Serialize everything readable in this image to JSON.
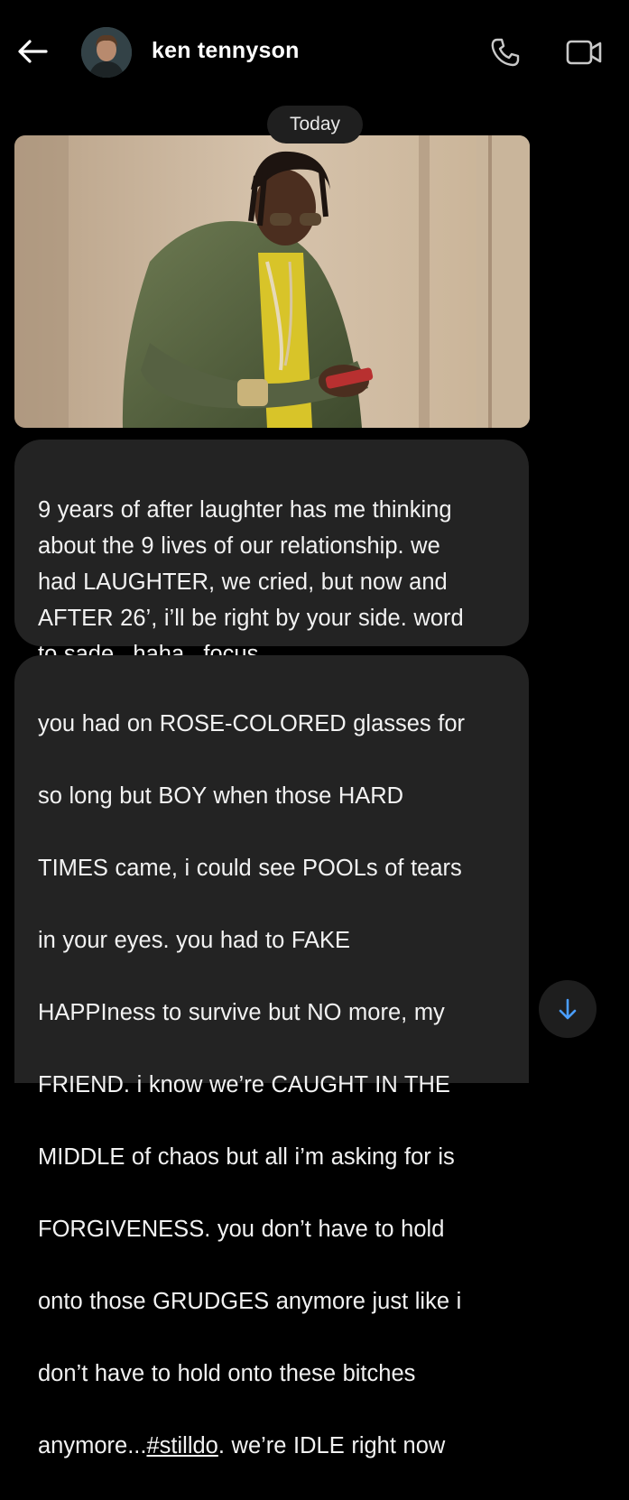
{
  "header": {
    "contact_name": "ken tennyson",
    "icons": {
      "back": "back-arrow-icon",
      "call": "phone-icon",
      "video": "video-camera-icon"
    }
  },
  "conversation": {
    "date_separator": "Today",
    "messages": [
      {
        "type": "image",
        "description_icon": "photo-attachment"
      },
      {
        "type": "text",
        "text": "9 years of after laughter has me thinking\nabout the 9 lives of our relationship. we\nhad LAUGHTER, we cried, but now and\nAFTER 26’, i’ll be right by your side. word\nto sade...haha...focus."
      },
      {
        "type": "text",
        "lines": [
          "you had on ROSE-COLORED glasses for",
          "so long but BOY when those HARD",
          "TIMES came, i could see POOLs of tears",
          "in your eyes. you had to FAKE",
          "HAPPIness to survive but NO more, my",
          "FRIEND. i know we’re CAUGHT IN THE",
          "MIDDLE of chaos but all i’m asking for is",
          "FORGIVENESS. you don’t have to hold",
          "onto those GRUDGES anymore just like i",
          "don’t have to hold onto these bitches"
        ],
        "last_line_before": "anymore...",
        "hashtag": "#stilldo",
        "last_line_after": ". we’re IDLE right now"
      }
    ]
  },
  "controls": {
    "scroll_down_icon": "arrow-down-icon",
    "accent_color": "#4a9eff"
  }
}
